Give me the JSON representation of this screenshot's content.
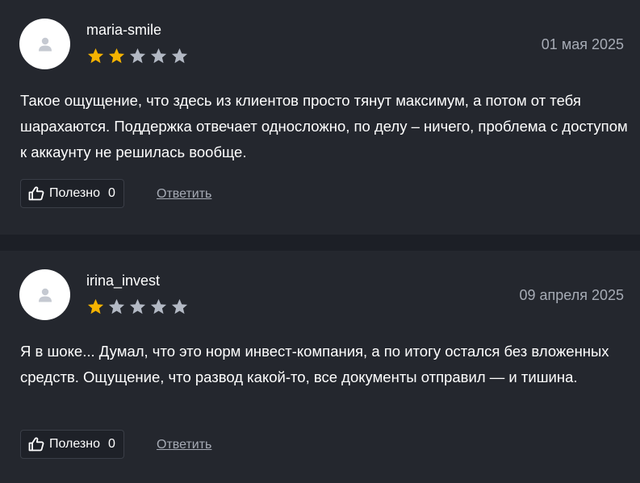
{
  "colors": {
    "background": "#1c1f26",
    "card": "#24272e",
    "star_filled": "#f5b301",
    "star_empty": "#b3b9c4",
    "muted_text": "#a6abb5"
  },
  "icons": {
    "avatar": "user-icon",
    "helpful": "thumbs-up-icon",
    "rating": "star-icon"
  },
  "reviews": [
    {
      "username": "maria-smile",
      "date": "01 мая 2025",
      "rating": 2,
      "max_rating": 5,
      "text": "Такое ощущение, что здесь из клиентов просто тянут максимум, а потом от тебя шарахаются. Поддержка отвечает односложно, по делу – ничего, проблема с доступом к аккаунту не решилась вообще.",
      "helpful_label": "Полезно",
      "helpful_count": "0",
      "reply_label": "Ответить"
    },
    {
      "username": "irina_invest",
      "date": "09 апреля 2025",
      "rating": 1,
      "max_rating": 5,
      "text": "Я в шоке... Думал, что это норм инвест-компания, а по итогу остался без вложенных средств. Ощущение, что развод какой-то, все документы отправил — и тишина.",
      "helpful_label": "Полезно",
      "helpful_count": "0",
      "reply_label": "Ответить"
    }
  ]
}
